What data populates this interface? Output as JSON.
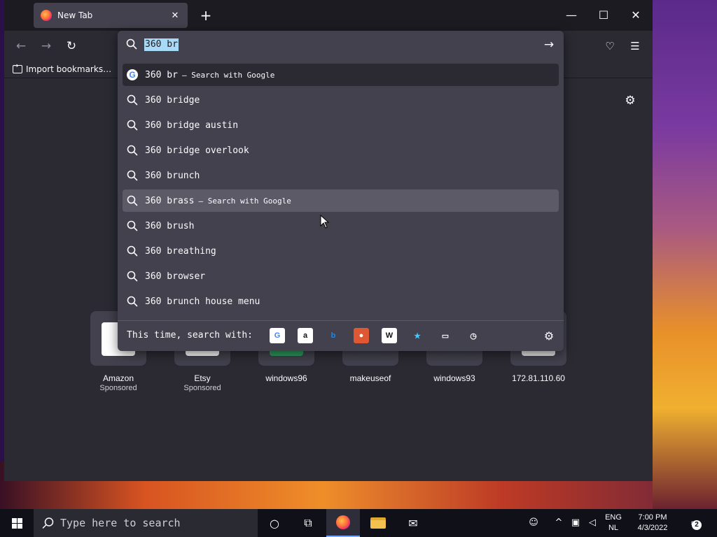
{
  "tab": {
    "title": "New Tab"
  },
  "window_controls": {
    "minimize": "—",
    "maximize": "☐",
    "close": "✕"
  },
  "bookmarks": {
    "import_label": "Import bookmarks…"
  },
  "urlbar": {
    "typed_text": "360 br",
    "suggestions": [
      {
        "text": "360 br",
        "suffix": "— Search with Google",
        "icon": "google-icon",
        "state": "selected"
      },
      {
        "text": "360 bridge",
        "suffix": "",
        "icon": "search-icon",
        "state": ""
      },
      {
        "text": "360 bridge austin",
        "suffix": "",
        "icon": "search-icon",
        "state": ""
      },
      {
        "text": "360 bridge overlook",
        "suffix": "",
        "icon": "search-icon",
        "state": ""
      },
      {
        "text": "360 brunch",
        "suffix": "",
        "icon": "search-icon",
        "state": ""
      },
      {
        "text": "360 brass",
        "suffix": "— Search with Google",
        "icon": "search-icon",
        "state": "hovered"
      },
      {
        "text": "360 brush",
        "suffix": "",
        "icon": "search-icon",
        "state": ""
      },
      {
        "text": "360 breathing",
        "suffix": "",
        "icon": "search-icon",
        "state": ""
      },
      {
        "text": "360 browser",
        "suffix": "",
        "icon": "search-icon",
        "state": ""
      },
      {
        "text": "360 brunch house menu",
        "suffix": "",
        "icon": "search-icon",
        "state": ""
      }
    ],
    "engine_bar_label": "This time, search with:",
    "engines": [
      {
        "name": "google-engine-icon",
        "glyph": "G",
        "color": "#4285f4",
        "bg": "#ffffff"
      },
      {
        "name": "amazon-engine-icon",
        "glyph": "a",
        "color": "#111111",
        "bg": "#ffffff"
      },
      {
        "name": "bing-engine-icon",
        "glyph": "b",
        "color": "#1e88e5",
        "bg": "transparent"
      },
      {
        "name": "duckduckgo-engine-icon",
        "glyph": "●",
        "color": "#ffffff",
        "bg": "#de5833"
      },
      {
        "name": "wikipedia-engine-icon",
        "glyph": "W",
        "color": "#111111",
        "bg": "#ffffff"
      },
      {
        "name": "bookmarks-engine-icon",
        "glyph": "★",
        "color": "#3fc8ff",
        "bg": "transparent"
      },
      {
        "name": "tabs-engine-icon",
        "glyph": "▭",
        "color": "#fbfbfe",
        "bg": "transparent"
      },
      {
        "name": "history-engine-icon",
        "glyph": "◷",
        "color": "#fbfbfe",
        "bg": "transparent"
      }
    ]
  },
  "shortcuts": [
    {
      "label": "Amazon",
      "sub": "Sponsored",
      "color": "#ffffff"
    },
    {
      "label": "Etsy",
      "sub": "Sponsored",
      "color": "#ffffff"
    },
    {
      "label": "windows96",
      "sub": "",
      "color": "#2e9e5e"
    },
    {
      "label": "makeuseof",
      "sub": "",
      "color": "#42414d"
    },
    {
      "label": "windows93",
      "sub": "",
      "color": "#42414d"
    },
    {
      "label": "172.81.110.60",
      "sub": "",
      "color": "#e8e8e8"
    }
  ],
  "taskbar": {
    "search_placeholder": "Type here to search",
    "lang_top": "ENG",
    "lang_bottom": "NL",
    "time": "7:00 PM",
    "date": "4/3/2022",
    "notification_count": "2"
  },
  "colors": {
    "accent_selection": "#a8d9f7",
    "popup_bg": "#42414d",
    "chrome_dark": "#1c1b22"
  }
}
